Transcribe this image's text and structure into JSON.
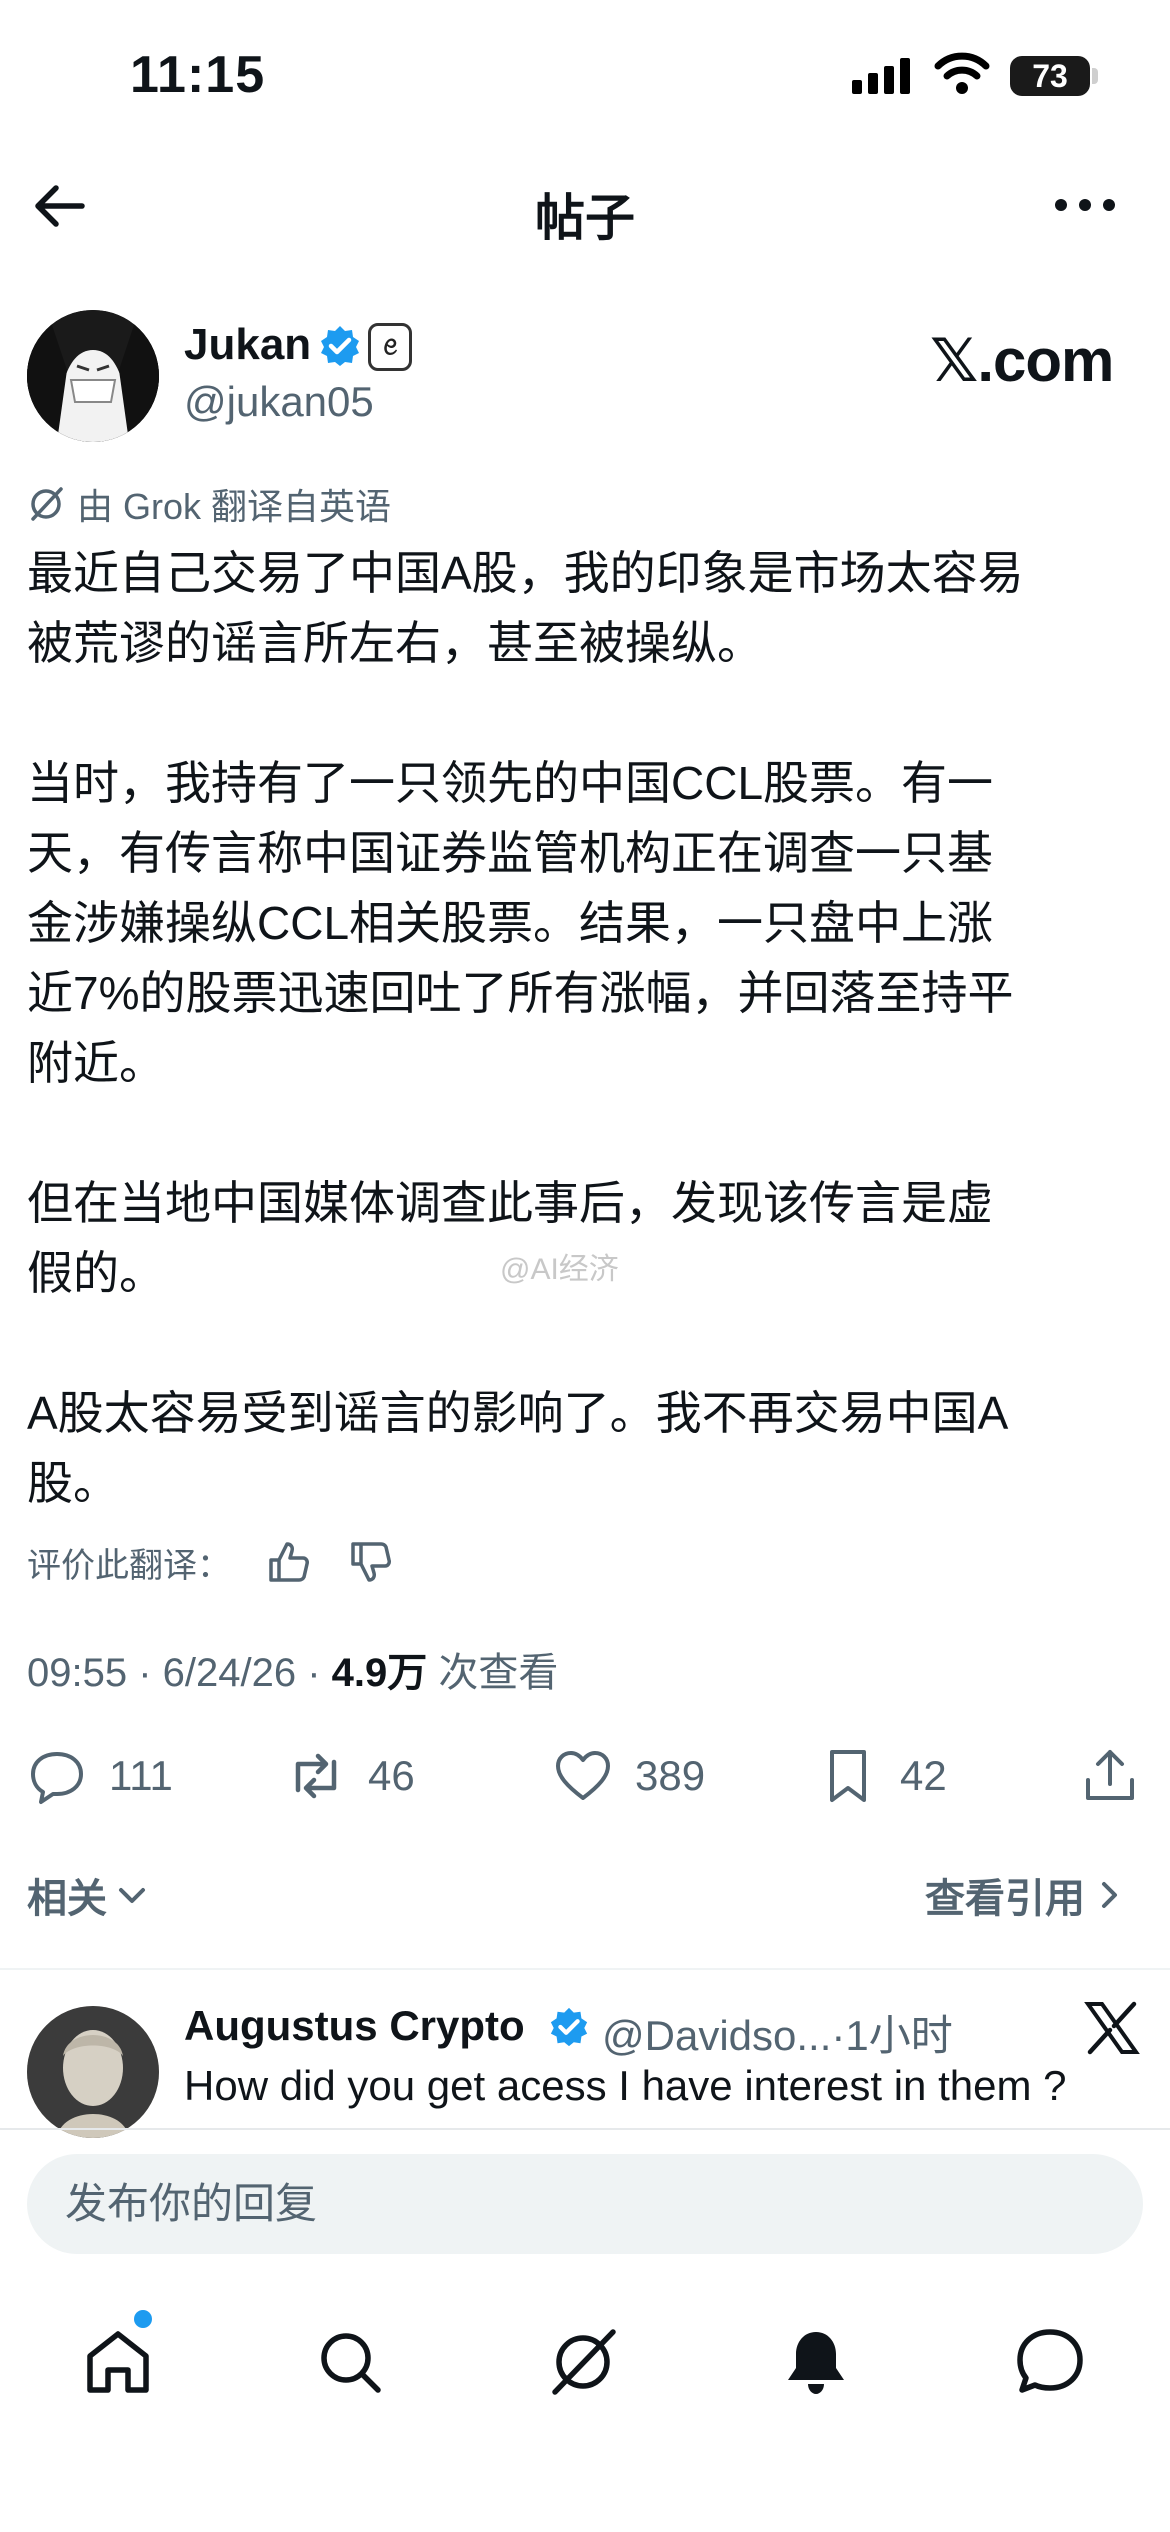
{
  "status_bar": {
    "time": "11:15",
    "battery": "73"
  },
  "header": {
    "title": "帖子"
  },
  "author": {
    "name": "Jukan",
    "handle": "@jukan05",
    "badge": "ꫀ",
    "source_logo": "𝕏.com"
  },
  "translation": {
    "label": "由 Grok 翻译自英语"
  },
  "post": {
    "text": "最近自己交易了中国A股，我的印象是市场太容易\n被荒谬的谣言所左右，甚至被操纵。\n\n当时，我持有了一只领先的中国CCL股票。有一\n天，有传言称中国证券监管机构正在调查一只基\n金涉嫌操纵CCL相关股票。结果，一只盘中上涨\n近7%的股票迅速回吐了所有涨幅，并回落至持平\n附近。\n\n但在当地中国媒体调查此事后，发现该传言是虚\n假的。\n\nA股太容易受到谣言的影响了。我不再交易中国A\n股。",
    "watermark": "@AI经济"
  },
  "rate_translation": {
    "label": "评价此翻译："
  },
  "meta": {
    "time": "09:55",
    "date": "6/24/26",
    "views": "4.9万",
    "views_label": "次查看"
  },
  "actions": {
    "replies": "111",
    "reposts": "46",
    "likes": "389",
    "bookmarks": "42"
  },
  "related": {
    "label": "相关",
    "quotes": "查看引用"
  },
  "reply": {
    "name": "Augustus Crypto",
    "handle": "@Davidso...",
    "time": "·1小时",
    "text": "How did you get acess I have interest in them ?"
  },
  "composer": {
    "placeholder": "发布你的回复"
  },
  "colors": {
    "accent": "#1d9bf0",
    "text": "#0f1419",
    "muted": "#536471"
  }
}
